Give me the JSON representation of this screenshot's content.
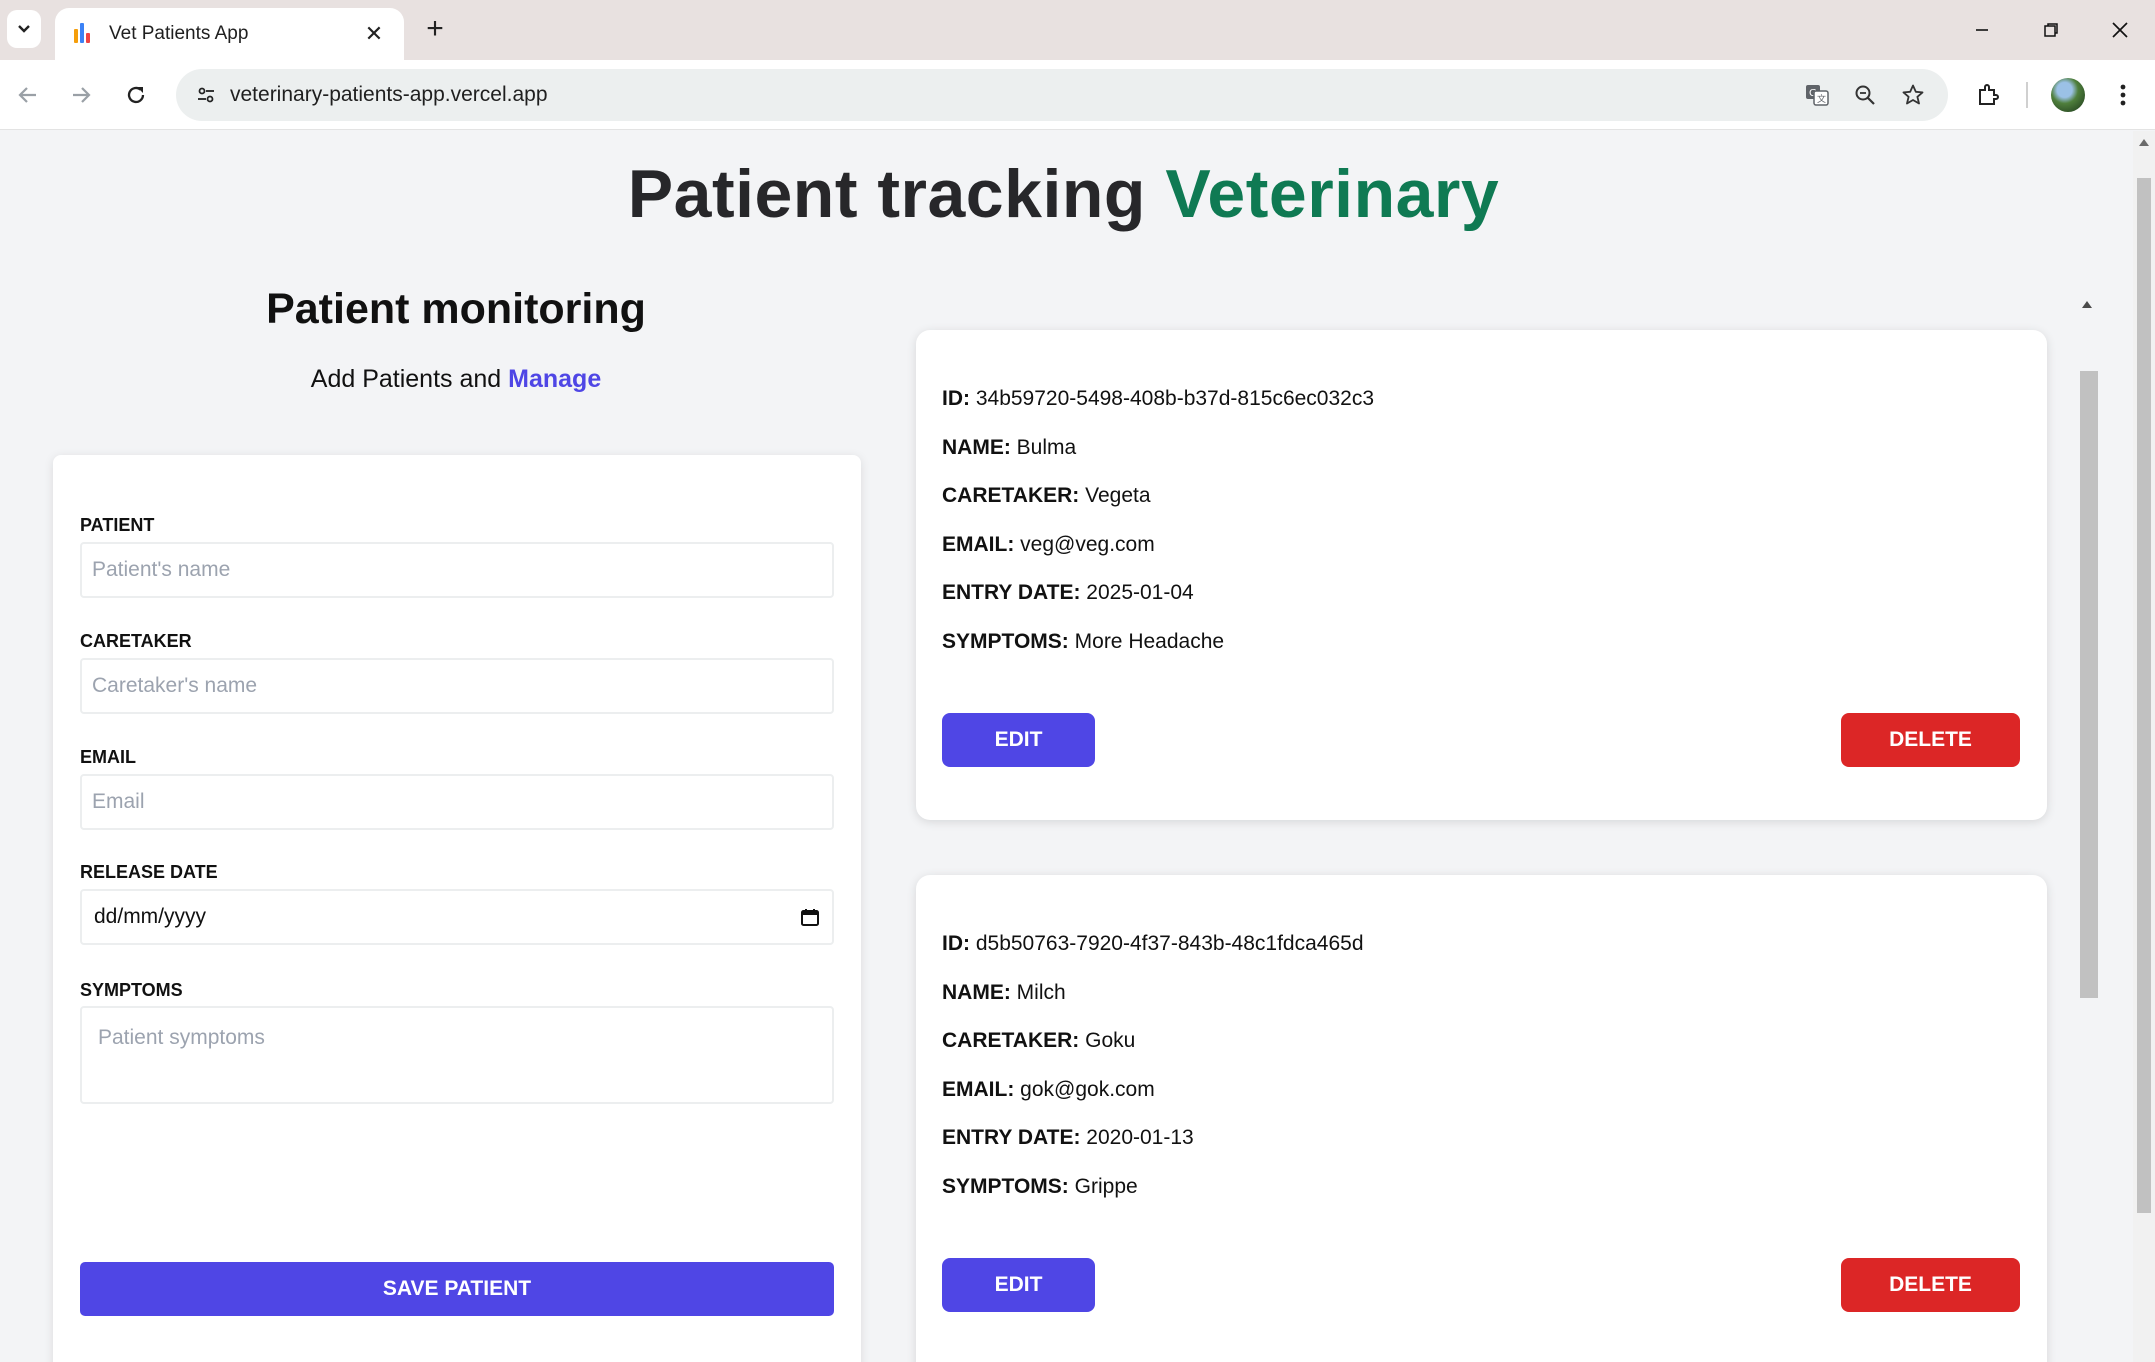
{
  "browser": {
    "tab_title": "Vet Patients App",
    "url": "veterinary-patients-app.vercel.app"
  },
  "header": {
    "title_part1": "Patient tracking",
    "title_part2": "Veterinary"
  },
  "left": {
    "title": "Patient monitoring",
    "subtitle_part1": "Add Patients and",
    "subtitle_part2": "Manage"
  },
  "form": {
    "patient_label": "PATIENT",
    "patient_placeholder": "Patient's name",
    "caretaker_label": "CARETAKER",
    "caretaker_placeholder": "Caretaker's name",
    "email_label": "EMAIL",
    "email_placeholder": "Email",
    "release_label": "RELEASE DATE",
    "release_value": "dd/mm/yyyy",
    "symptoms_label": "SYMPTOMS",
    "symptoms_placeholder": "Patient symptoms",
    "save_label": "SAVE PATIENT"
  },
  "labels": {
    "id": "ID:",
    "name": "NAME:",
    "caretaker": "CARETAKER:",
    "email": "EMAIL:",
    "entry_date": "ENTRY DATE:",
    "symptoms": "SYMPTOMS:",
    "edit": "EDIT",
    "delete": "DELETE"
  },
  "patients": [
    {
      "id": "34b59720-5498-408b-b37d-815c6ec032c3",
      "name": "Bulma",
      "caretaker": "Vegeta",
      "email": "veg@veg.com",
      "entry_date": "2025-01-04",
      "symptoms": "More Headache"
    },
    {
      "id": "d5b50763-7920-4f37-843b-48c1fdca465d",
      "name": "Milch",
      "caretaker": "Goku",
      "email": "gok@gok.com",
      "entry_date": "2020-01-13",
      "symptoms": "Grippe"
    }
  ],
  "colors": {
    "accent_green": "#0f7a53",
    "primary": "#4f46e5",
    "danger": "#dc2626",
    "page_bg": "#f3f4f6"
  }
}
